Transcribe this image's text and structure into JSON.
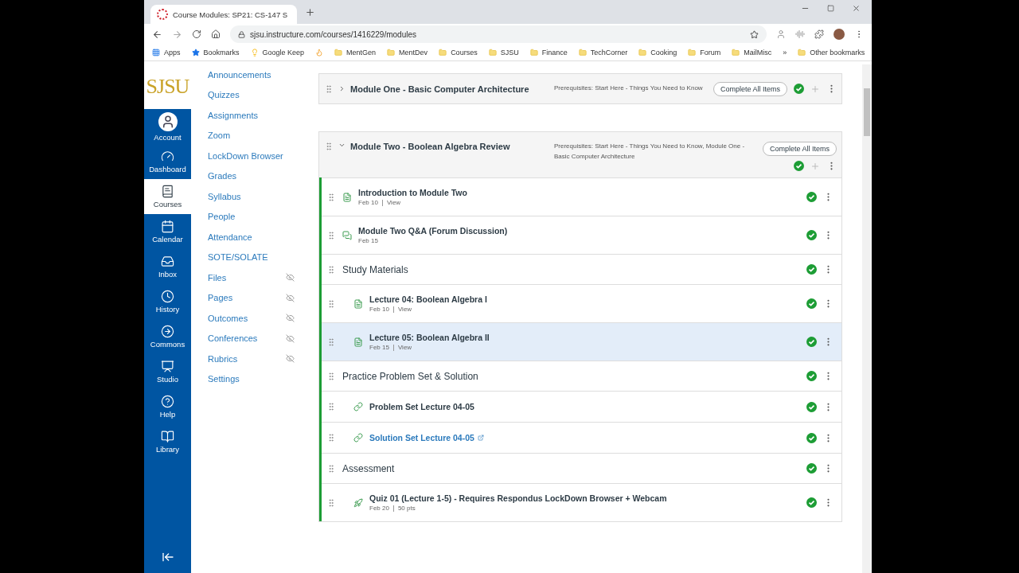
{
  "browser": {
    "tab_title": "Course Modules: SP21: CS-147 S",
    "url": "sjsu.instructure.com/courses/1416229/modules",
    "bookmarks": [
      {
        "kind": "apps",
        "label": "Apps"
      },
      {
        "kind": "star",
        "label": "Bookmarks"
      },
      {
        "kind": "keep",
        "label": "Google Keep"
      },
      {
        "kind": "app"
      },
      {
        "kind": "folder",
        "label": "MentGen"
      },
      {
        "kind": "folder",
        "label": "MentDev"
      },
      {
        "kind": "folder",
        "label": "Courses"
      },
      {
        "kind": "folder",
        "label": "SJSU"
      },
      {
        "kind": "folder",
        "label": "Finance"
      },
      {
        "kind": "folder",
        "label": "TechCorner"
      },
      {
        "kind": "folder",
        "label": "Cooking"
      },
      {
        "kind": "folder",
        "label": "Forum"
      },
      {
        "kind": "folder",
        "label": "MailMisc"
      }
    ],
    "overflow": "»",
    "other_bookmarks": "Other bookmarks"
  },
  "global_nav": {
    "logo": "SJSU",
    "items": [
      {
        "label": "Account",
        "selected": false
      },
      {
        "label": "Dashboard",
        "selected": false
      },
      {
        "label": "Courses",
        "selected": true
      },
      {
        "label": "Calendar",
        "selected": false
      },
      {
        "label": "Inbox",
        "selected": false
      },
      {
        "label": "History",
        "selected": false
      },
      {
        "label": "Commons",
        "selected": false
      },
      {
        "label": "Studio",
        "selected": false
      },
      {
        "label": "Help",
        "selected": false
      },
      {
        "label": "Library",
        "selected": false
      }
    ]
  },
  "course_nav": [
    {
      "label": "Announcements",
      "hidden": false
    },
    {
      "label": "Quizzes",
      "hidden": false
    },
    {
      "label": "Assignments",
      "hidden": false
    },
    {
      "label": "Zoom",
      "hidden": false
    },
    {
      "label": "LockDown Browser",
      "hidden": false
    },
    {
      "label": "Grades",
      "hidden": false
    },
    {
      "label": "Syllabus",
      "hidden": false
    },
    {
      "label": "People",
      "hidden": false
    },
    {
      "label": "Attendance",
      "hidden": false
    },
    {
      "label": "SOTE/SOLATE",
      "hidden": false
    },
    {
      "label": "Files",
      "hidden": true
    },
    {
      "label": "Pages",
      "hidden": true
    },
    {
      "label": "Outcomes",
      "hidden": true
    },
    {
      "label": "Conferences",
      "hidden": true
    },
    {
      "label": "Rubrics",
      "hidden": true
    },
    {
      "label": "Settings",
      "hidden": false
    }
  ],
  "modules": [
    {
      "title": "Module One - Basic Computer Architecture",
      "expanded": false,
      "prerequisites": "Prerequisites: Start Here - Things You Need to Know",
      "button": "Complete All Items"
    },
    {
      "title": "Module Two - Boolean Algebra Review",
      "expanded": true,
      "prerequisites": "Prerequisites: Start Here - Things You Need to Know, Module One - Basic Computer Architecture",
      "button": "Complete All Items",
      "items": [
        {
          "kind": "page",
          "title": "Introduction to Module Two",
          "meta": [
            "Feb 10",
            "View"
          ],
          "highlighted": false
        },
        {
          "kind": "discussion",
          "title": "Module Two Q&A (Forum Discussion)",
          "meta": [
            "Feb 15"
          ],
          "highlighted": false
        },
        {
          "kind": "subheader",
          "title": "Study Materials",
          "highlighted": false,
          "children": [
            {
              "kind": "page",
              "title": "Lecture 04: Boolean Algebra I",
              "meta": [
                "Feb 10",
                "View"
              ],
              "highlighted": false
            },
            {
              "kind": "page",
              "title": "Lecture 05: Boolean Algebra II",
              "meta": [
                "Feb 15",
                "View"
              ],
              "highlighted": true
            }
          ]
        },
        {
          "kind": "subheader",
          "title": "Practice Problem Set & Solution",
          "highlighted": false,
          "children": [
            {
              "kind": "link",
              "title": "Problem Set Lecture 04-05",
              "highlighted": false
            },
            {
              "kind": "external_link",
              "title": "Solution Set Lecture 04-05",
              "highlighted": false
            }
          ]
        },
        {
          "kind": "subheader",
          "title": "Assessment",
          "highlighted": false,
          "children": [
            {
              "kind": "quiz",
              "title": "Quiz 01 (Lecture 1-5) - Requires Respondus LockDown Browser + Webcam",
              "meta": [
                "Feb 20",
                "50 pts"
              ],
              "highlighted": false
            }
          ]
        }
      ]
    }
  ]
}
